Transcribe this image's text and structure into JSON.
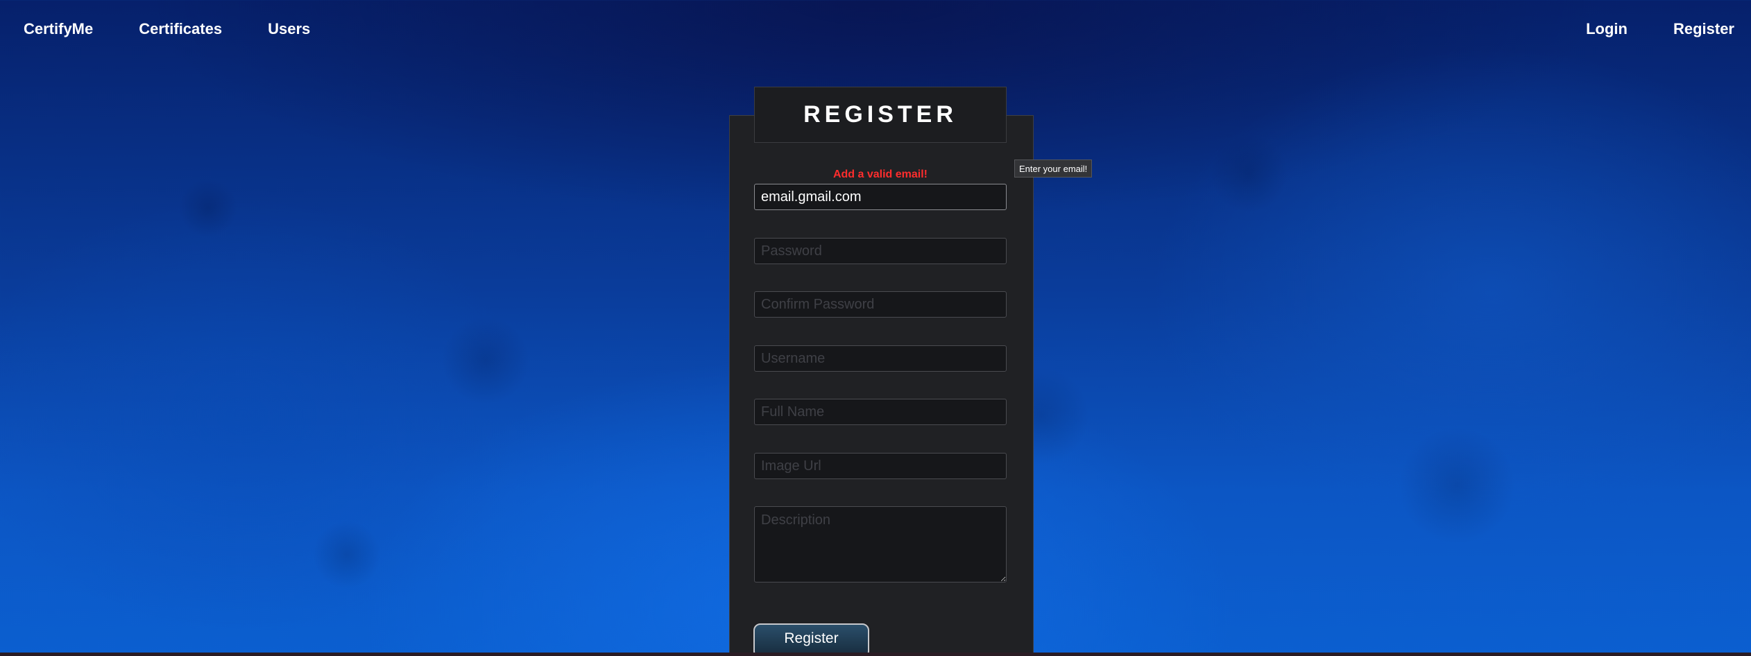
{
  "nav": {
    "brand": "CertifyMe",
    "links": [
      "Certificates",
      "Users"
    ],
    "login": "Login",
    "register": "Register"
  },
  "form": {
    "title": "REGISTER",
    "error": "Add a valid email!",
    "tooltip": "Enter your email!",
    "email": {
      "value": "email.gmail.com"
    },
    "password": {
      "placeholder": "Password"
    },
    "confirm_password": {
      "placeholder": "Confirm Password"
    },
    "username": {
      "placeholder": "Username"
    },
    "full_name": {
      "placeholder": "Full Name"
    },
    "image_url": {
      "placeholder": "Image Url"
    },
    "description": {
      "placeholder": "Description"
    },
    "submit_label": "Register"
  },
  "colors": {
    "error": "#ff2d2d",
    "panel": "#202124",
    "background": "#0a3d9c"
  }
}
